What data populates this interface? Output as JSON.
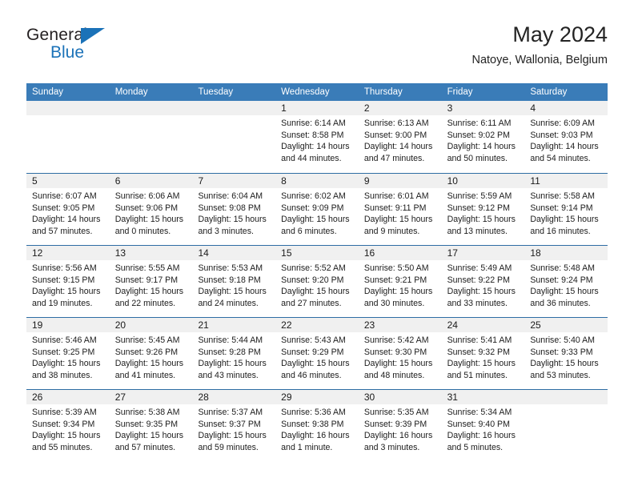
{
  "brand": {
    "name_part1": "General",
    "name_part2": "Blue",
    "triangle_color": "#1b72b8"
  },
  "header": {
    "title": "May 2024",
    "subtitle": "Natoye, Wallonia, Belgium"
  },
  "theme": {
    "header_bg": "#3a7cb8",
    "row_divider": "#2e6da4",
    "date_band": "#f0f0f0"
  },
  "weekday_headers": [
    "Sunday",
    "Monday",
    "Tuesday",
    "Wednesday",
    "Thursday",
    "Friday",
    "Saturday"
  ],
  "weeks": [
    {
      "days": [
        {
          "date": "",
          "empty": true,
          "sunrise": "",
          "sunset": "",
          "daylight_line1": "",
          "daylight_line2": ""
        },
        {
          "date": "",
          "empty": true,
          "sunrise": "",
          "sunset": "",
          "daylight_line1": "",
          "daylight_line2": ""
        },
        {
          "date": "",
          "empty": true,
          "sunrise": "",
          "sunset": "",
          "daylight_line1": "",
          "daylight_line2": ""
        },
        {
          "date": "1",
          "empty": false,
          "sunrise": "Sunrise: 6:14 AM",
          "sunset": "Sunset: 8:58 PM",
          "daylight_line1": "Daylight: 14 hours",
          "daylight_line2": "and 44 minutes."
        },
        {
          "date": "2",
          "empty": false,
          "sunrise": "Sunrise: 6:13 AM",
          "sunset": "Sunset: 9:00 PM",
          "daylight_line1": "Daylight: 14 hours",
          "daylight_line2": "and 47 minutes."
        },
        {
          "date": "3",
          "empty": false,
          "sunrise": "Sunrise: 6:11 AM",
          "sunset": "Sunset: 9:02 PM",
          "daylight_line1": "Daylight: 14 hours",
          "daylight_line2": "and 50 minutes."
        },
        {
          "date": "4",
          "empty": false,
          "sunrise": "Sunrise: 6:09 AM",
          "sunset": "Sunset: 9:03 PM",
          "daylight_line1": "Daylight: 14 hours",
          "daylight_line2": "and 54 minutes."
        }
      ]
    },
    {
      "days": [
        {
          "date": "5",
          "empty": false,
          "sunrise": "Sunrise: 6:07 AM",
          "sunset": "Sunset: 9:05 PM",
          "daylight_line1": "Daylight: 14 hours",
          "daylight_line2": "and 57 minutes."
        },
        {
          "date": "6",
          "empty": false,
          "sunrise": "Sunrise: 6:06 AM",
          "sunset": "Sunset: 9:06 PM",
          "daylight_line1": "Daylight: 15 hours",
          "daylight_line2": "and 0 minutes."
        },
        {
          "date": "7",
          "empty": false,
          "sunrise": "Sunrise: 6:04 AM",
          "sunset": "Sunset: 9:08 PM",
          "daylight_line1": "Daylight: 15 hours",
          "daylight_line2": "and 3 minutes."
        },
        {
          "date": "8",
          "empty": false,
          "sunrise": "Sunrise: 6:02 AM",
          "sunset": "Sunset: 9:09 PM",
          "daylight_line1": "Daylight: 15 hours",
          "daylight_line2": "and 6 minutes."
        },
        {
          "date": "9",
          "empty": false,
          "sunrise": "Sunrise: 6:01 AM",
          "sunset": "Sunset: 9:11 PM",
          "daylight_line1": "Daylight: 15 hours",
          "daylight_line2": "and 9 minutes."
        },
        {
          "date": "10",
          "empty": false,
          "sunrise": "Sunrise: 5:59 AM",
          "sunset": "Sunset: 9:12 PM",
          "daylight_line1": "Daylight: 15 hours",
          "daylight_line2": "and 13 minutes."
        },
        {
          "date": "11",
          "empty": false,
          "sunrise": "Sunrise: 5:58 AM",
          "sunset": "Sunset: 9:14 PM",
          "daylight_line1": "Daylight: 15 hours",
          "daylight_line2": "and 16 minutes."
        }
      ]
    },
    {
      "days": [
        {
          "date": "12",
          "empty": false,
          "sunrise": "Sunrise: 5:56 AM",
          "sunset": "Sunset: 9:15 PM",
          "daylight_line1": "Daylight: 15 hours",
          "daylight_line2": "and 19 minutes."
        },
        {
          "date": "13",
          "empty": false,
          "sunrise": "Sunrise: 5:55 AM",
          "sunset": "Sunset: 9:17 PM",
          "daylight_line1": "Daylight: 15 hours",
          "daylight_line2": "and 22 minutes."
        },
        {
          "date": "14",
          "empty": false,
          "sunrise": "Sunrise: 5:53 AM",
          "sunset": "Sunset: 9:18 PM",
          "daylight_line1": "Daylight: 15 hours",
          "daylight_line2": "and 24 minutes."
        },
        {
          "date": "15",
          "empty": false,
          "sunrise": "Sunrise: 5:52 AM",
          "sunset": "Sunset: 9:20 PM",
          "daylight_line1": "Daylight: 15 hours",
          "daylight_line2": "and 27 minutes."
        },
        {
          "date": "16",
          "empty": false,
          "sunrise": "Sunrise: 5:50 AM",
          "sunset": "Sunset: 9:21 PM",
          "daylight_line1": "Daylight: 15 hours",
          "daylight_line2": "and 30 minutes."
        },
        {
          "date": "17",
          "empty": false,
          "sunrise": "Sunrise: 5:49 AM",
          "sunset": "Sunset: 9:22 PM",
          "daylight_line1": "Daylight: 15 hours",
          "daylight_line2": "and 33 minutes."
        },
        {
          "date": "18",
          "empty": false,
          "sunrise": "Sunrise: 5:48 AM",
          "sunset": "Sunset: 9:24 PM",
          "daylight_line1": "Daylight: 15 hours",
          "daylight_line2": "and 36 minutes."
        }
      ]
    },
    {
      "days": [
        {
          "date": "19",
          "empty": false,
          "sunrise": "Sunrise: 5:46 AM",
          "sunset": "Sunset: 9:25 PM",
          "daylight_line1": "Daylight: 15 hours",
          "daylight_line2": "and 38 minutes."
        },
        {
          "date": "20",
          "empty": false,
          "sunrise": "Sunrise: 5:45 AM",
          "sunset": "Sunset: 9:26 PM",
          "daylight_line1": "Daylight: 15 hours",
          "daylight_line2": "and 41 minutes."
        },
        {
          "date": "21",
          "empty": false,
          "sunrise": "Sunrise: 5:44 AM",
          "sunset": "Sunset: 9:28 PM",
          "daylight_line1": "Daylight: 15 hours",
          "daylight_line2": "and 43 minutes."
        },
        {
          "date": "22",
          "empty": false,
          "sunrise": "Sunrise: 5:43 AM",
          "sunset": "Sunset: 9:29 PM",
          "daylight_line1": "Daylight: 15 hours",
          "daylight_line2": "and 46 minutes."
        },
        {
          "date": "23",
          "empty": false,
          "sunrise": "Sunrise: 5:42 AM",
          "sunset": "Sunset: 9:30 PM",
          "daylight_line1": "Daylight: 15 hours",
          "daylight_line2": "and 48 minutes."
        },
        {
          "date": "24",
          "empty": false,
          "sunrise": "Sunrise: 5:41 AM",
          "sunset": "Sunset: 9:32 PM",
          "daylight_line1": "Daylight: 15 hours",
          "daylight_line2": "and 51 minutes."
        },
        {
          "date": "25",
          "empty": false,
          "sunrise": "Sunrise: 5:40 AM",
          "sunset": "Sunset: 9:33 PM",
          "daylight_line1": "Daylight: 15 hours",
          "daylight_line2": "and 53 minutes."
        }
      ]
    },
    {
      "days": [
        {
          "date": "26",
          "empty": false,
          "sunrise": "Sunrise: 5:39 AM",
          "sunset": "Sunset: 9:34 PM",
          "daylight_line1": "Daylight: 15 hours",
          "daylight_line2": "and 55 minutes."
        },
        {
          "date": "27",
          "empty": false,
          "sunrise": "Sunrise: 5:38 AM",
          "sunset": "Sunset: 9:35 PM",
          "daylight_line1": "Daylight: 15 hours",
          "daylight_line2": "and 57 minutes."
        },
        {
          "date": "28",
          "empty": false,
          "sunrise": "Sunrise: 5:37 AM",
          "sunset": "Sunset: 9:37 PM",
          "daylight_line1": "Daylight: 15 hours",
          "daylight_line2": "and 59 minutes."
        },
        {
          "date": "29",
          "empty": false,
          "sunrise": "Sunrise: 5:36 AM",
          "sunset": "Sunset: 9:38 PM",
          "daylight_line1": "Daylight: 16 hours",
          "daylight_line2": "and 1 minute."
        },
        {
          "date": "30",
          "empty": false,
          "sunrise": "Sunrise: 5:35 AM",
          "sunset": "Sunset: 9:39 PM",
          "daylight_line1": "Daylight: 16 hours",
          "daylight_line2": "and 3 minutes."
        },
        {
          "date": "31",
          "empty": false,
          "sunrise": "Sunrise: 5:34 AM",
          "sunset": "Sunset: 9:40 PM",
          "daylight_line1": "Daylight: 16 hours",
          "daylight_line2": "and 5 minutes."
        },
        {
          "date": "",
          "empty": true,
          "sunrise": "",
          "sunset": "",
          "daylight_line1": "",
          "daylight_line2": ""
        }
      ]
    }
  ]
}
